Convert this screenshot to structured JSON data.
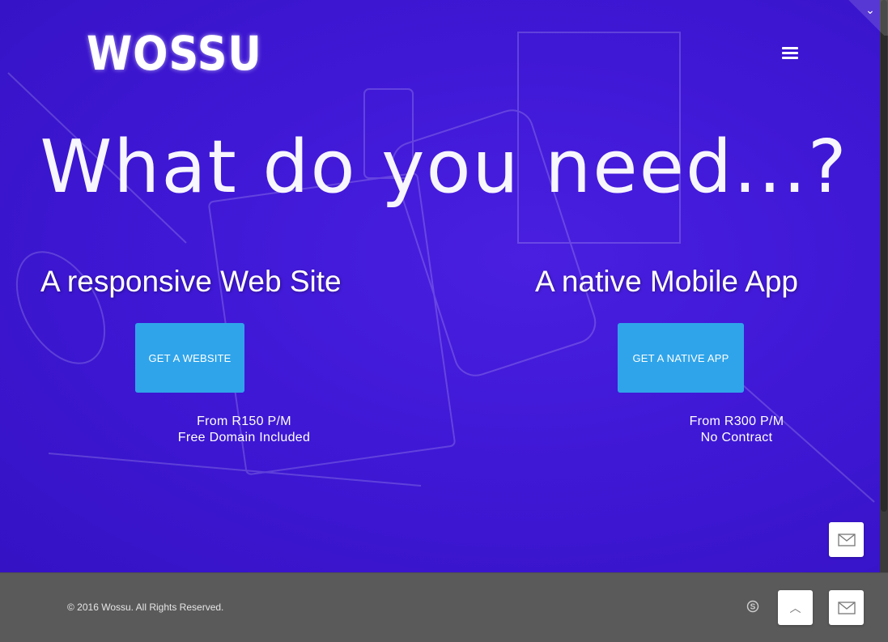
{
  "logo": {
    "text": "WOSSU"
  },
  "hero": {
    "headline": "What do you need...?",
    "website": {
      "title": "A responsive Web Site",
      "button_label": "GET A WEBSITE",
      "price_line1": "From R150 P/M",
      "price_line2": "Free Domain Included"
    },
    "app": {
      "title": "A native Mobile App",
      "button_label": "GET A NATIVE APP",
      "price_line1": "From R300 P/M",
      "price_line2": "No Contract"
    }
  },
  "footer": {
    "copyright": "© 2016 Wossu. All Rights Reserved."
  },
  "icons": {
    "menu": "hamburger-menu-icon",
    "corner": "chevron-down-icon",
    "skype": "skype-icon",
    "mail": "envelope-icon",
    "back_to_top": "chevron-up-icon"
  },
  "colors": {
    "hero_overlay": "#3f18d6",
    "button": "#2fa4ea",
    "footer": "#5a5a5a",
    "text": "#ffffff"
  }
}
